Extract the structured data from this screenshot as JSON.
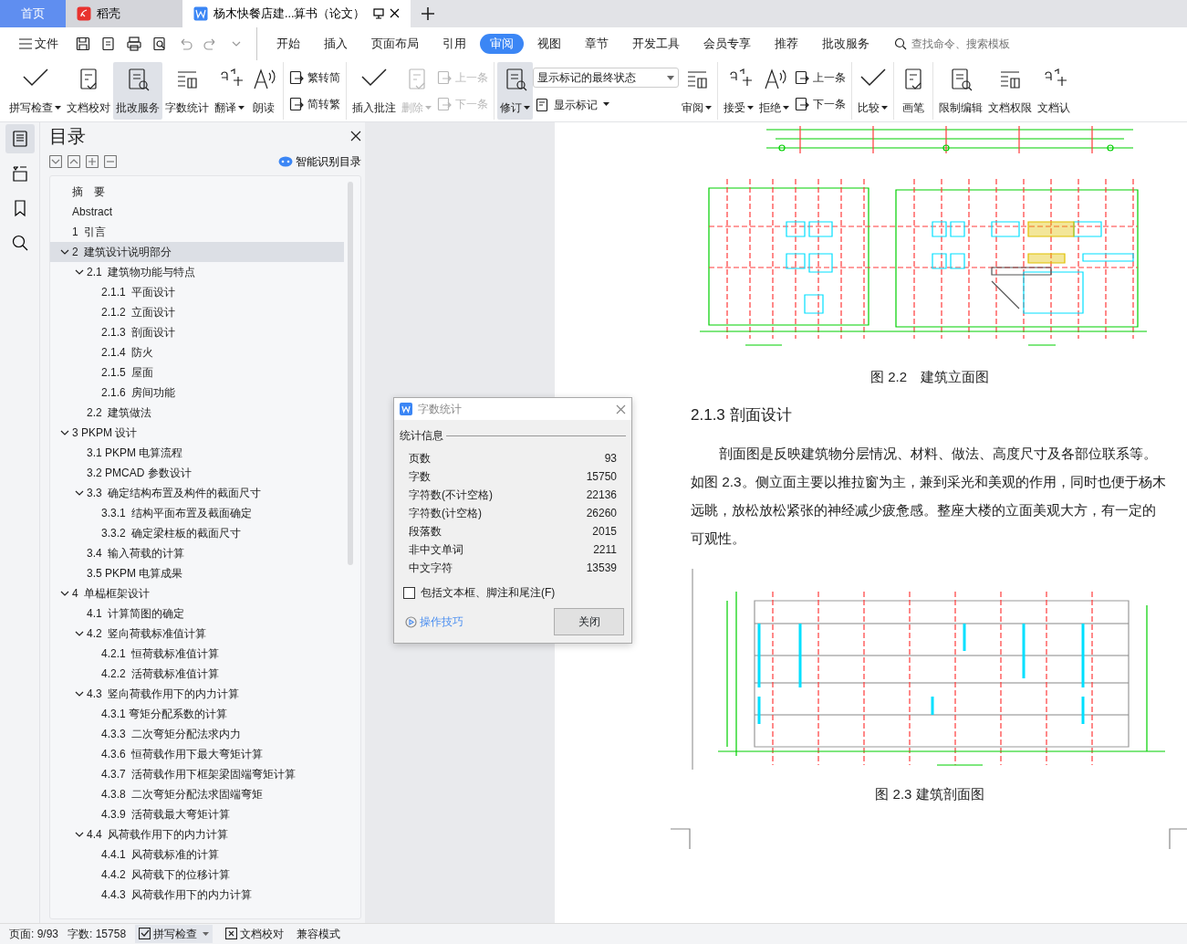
{
  "tabs": [
    {
      "kind": "home",
      "label": "首页",
      "selected": false
    },
    {
      "kind": "app",
      "label": "稻壳",
      "selected": false
    },
    {
      "kind": "doc",
      "label": "杨木快餐店建...算书（论文）",
      "selected": true
    }
  ],
  "menu": {
    "file": "文件",
    "tabs": [
      {
        "label": "开始",
        "selected": false
      },
      {
        "label": "插入",
        "selected": false
      },
      {
        "label": "页面布局",
        "selected": false
      },
      {
        "label": "引用",
        "selected": false
      },
      {
        "label": "审阅",
        "selected": true
      },
      {
        "label": "视图",
        "selected": false
      },
      {
        "label": "章节",
        "selected": false
      },
      {
        "label": "开发工具",
        "selected": false
      },
      {
        "label": "会员专享",
        "selected": false
      },
      {
        "label": "推荐",
        "selected": false
      },
      {
        "label": "批改服务",
        "selected": false
      }
    ],
    "search": {
      "placeholder": "查找命令、搜索模板"
    }
  },
  "ribbon": [
    {
      "items": [
        {
          "kind": "big",
          "label": "拼写检查",
          "menu": true,
          "disabled": false,
          "selected": false
        },
        {
          "kind": "big",
          "label": "文档校对",
          "menu": false,
          "disabled": false,
          "selected": false
        },
        {
          "kind": "big",
          "label": "批改服务",
          "menu": false,
          "disabled": false,
          "selected": true
        },
        {
          "kind": "big",
          "label": "字数统计",
          "menu": false,
          "disabled": false,
          "selected": false
        },
        {
          "kind": "big",
          "label": "翻译",
          "menu": true,
          "disabled": false,
          "selected": false
        },
        {
          "kind": "big",
          "label": "朗读",
          "menu": false,
          "disabled": false,
          "selected": false
        }
      ]
    },
    {
      "items": [
        {
          "kind": "stack",
          "entries": [
            {
              "label": "繁转简",
              "disabled": false
            },
            {
              "label": "简转繁",
              "disabled": false
            }
          ]
        }
      ]
    },
    {
      "items": [
        {
          "kind": "big",
          "label": "插入批注",
          "menu": false,
          "disabled": false,
          "selected": false
        },
        {
          "kind": "big",
          "label": "删除",
          "menu": true,
          "disabled": true,
          "selected": false
        },
        {
          "kind": "stack",
          "entries": [
            {
              "label": "上一条",
              "disabled": true
            },
            {
              "label": "下一条",
              "disabled": true
            }
          ]
        }
      ]
    },
    {
      "items": [
        {
          "kind": "big",
          "label": "修订",
          "menu": true,
          "disabled": false,
          "selected": true
        },
        {
          "kind": "select",
          "value": "显示标记的最终状态",
          "entry": {
            "label": "显示标记",
            "menu": true
          }
        },
        {
          "kind": "big",
          "label": "审阅",
          "menu": true,
          "disabled": false,
          "selected": false
        }
      ]
    },
    {
      "items": [
        {
          "kind": "big",
          "label": "接受",
          "menu": true,
          "disabled": false,
          "selected": false
        },
        {
          "kind": "big",
          "label": "拒绝",
          "menu": true,
          "disabled": false,
          "selected": false
        },
        {
          "kind": "stack",
          "entries": [
            {
              "label": "上一条",
              "disabled": false
            },
            {
              "label": "下一条",
              "disabled": false
            }
          ]
        }
      ]
    },
    {
      "items": [
        {
          "kind": "big",
          "label": "比较",
          "menu": true,
          "disabled": false,
          "selected": false
        }
      ]
    },
    {
      "items": [
        {
          "kind": "big",
          "label": "画笔",
          "menu": false,
          "disabled": false,
          "selected": false
        }
      ]
    },
    {
      "items": [
        {
          "kind": "big",
          "label": "限制编辑",
          "menu": false,
          "disabled": false,
          "selected": false
        },
        {
          "kind": "big",
          "label": "文档权限",
          "menu": false,
          "disabled": false,
          "selected": false
        },
        {
          "kind": "big",
          "label": "文档认",
          "menu": false,
          "disabled": false,
          "selected": false
        }
      ]
    }
  ],
  "rail": [
    {
      "selected": true
    },
    {
      "selected": false
    },
    {
      "selected": false
    },
    {
      "selected": false
    }
  ],
  "outline": {
    "title": "目录",
    "smart_button": "智能识别目录",
    "items": [
      {
        "label": "摘　要",
        "selected": false
      },
      {
        "label": "Abstract",
        "selected": false
      },
      {
        "label": "1  引言",
        "selected": false
      },
      {
        "label": "2  建筑设计说明部分",
        "selected": true,
        "expanded": true,
        "children": [
          {
            "label": "2.1  建筑物功能与特点",
            "selected": false,
            "expanded": true,
            "children": [
              {
                "label": "2.1.1  平面设计",
                "selected": false
              },
              {
                "label": "2.1.2  立面设计",
                "selected": false
              },
              {
                "label": "2.1.3  剖面设计",
                "selected": false
              },
              {
                "label": "2.1.4  防火",
                "selected": false
              },
              {
                "label": "2.1.5  屋面",
                "selected": false
              },
              {
                "label": "2.1.6  房间功能",
                "selected": false
              }
            ]
          },
          {
            "label": "2.2  建筑做法",
            "selected": false
          }
        ]
      },
      {
        "label": "3 PKPM 设计",
        "selected": false,
        "expanded": true,
        "children": [
          {
            "label": "3.1 PKPM 电算流程",
            "selected": false
          },
          {
            "label": "3.2 PMCAD 参数设计",
            "selected": false
          },
          {
            "label": "3.3  确定结构布置及构件的截面尺寸",
            "selected": false,
            "expanded": true,
            "children": [
              {
                "label": "3.3.1  结构平面布置及截面确定",
                "selected": false
              },
              {
                "label": "3.3.2  确定梁柱板的截面尺寸",
                "selected": false
              }
            ]
          },
          {
            "label": "3.4  输入荷载的计算",
            "selected": false
          },
          {
            "label": "3.5 PKPM 电算成果",
            "selected": false
          }
        ]
      },
      {
        "label": "4  单榀框架设计",
        "selected": false,
        "expanded": true,
        "children": [
          {
            "label": "4.1  计算简图的确定",
            "selected": false
          },
          {
            "label": "4.2  竖向荷载标准值计算",
            "selected": false,
            "expanded": true,
            "children": [
              {
                "label": "4.2.1  恒荷载标准值计算",
                "selected": false
              },
              {
                "label": "4.2.2  活荷载标准值计算",
                "selected": false
              }
            ]
          },
          {
            "label": "4.3  竖向荷载作用下的内力计算",
            "selected": false,
            "expanded": true,
            "children": [
              {
                "label": "4.3.1 弯矩分配系数的计算",
                "selected": false
              },
              {
                "label": "4.3.3  二次弯矩分配法求内力",
                "selected": false
              },
              {
                "label": "4.3.6  恒荷载作用下最大弯矩计算",
                "selected": false
              },
              {
                "label": "4.3.7  活荷载作用下框架梁固端弯矩计算",
                "selected": false
              },
              {
                "label": "4.3.8  二次弯矩分配法求固端弯矩",
                "selected": false
              },
              {
                "label": "4.3.9  活荷载最大弯矩计算",
                "selected": false
              }
            ]
          },
          {
            "label": "4.4  风荷载作用下的内力计算",
            "selected": false,
            "expanded": true,
            "children": [
              {
                "label": "4.4.1  风荷载标准的计算",
                "selected": false
              },
              {
                "label": "4.4.2  风荷载下的位移计算",
                "selected": false
              },
              {
                "label": "4.4.3  风荷载作用下的内力计算",
                "selected": false
              }
            ]
          }
        ]
      }
    ]
  },
  "document": {
    "blocks": [
      {
        "kind": "plan"
      },
      {
        "kind": "elevation"
      },
      {
        "kind": "caption",
        "text": "图 2.2　建筑立面图"
      },
      {
        "kind": "heading",
        "text": "2.1.3  剖面设计"
      },
      {
        "kind": "paragraph",
        "text": "剖面图是反映建筑物分层情况、材料、做法、高度尺寸及各部位联系等。如图 2.3。侧立面主要以推拉窗为主，兼到采光和美观的作用，同时也便于杨木远眺，放松放松紧张的神经减少疲惫感。整座大楼的立面美观大方，有一定的可观性。"
      },
      {
        "kind": "section"
      },
      {
        "kind": "caption",
        "text": "图 2.3 建筑剖面图"
      }
    ]
  },
  "dialog": {
    "title": "字数统计",
    "group": "统计信息",
    "rows": [
      {
        "label": "页数",
        "value": "93"
      },
      {
        "label": "字数",
        "value": "15750"
      },
      {
        "label": "字符数(不计空格)",
        "value": "22136"
      },
      {
        "label": "字符数(计空格)",
        "value": "26260"
      },
      {
        "label": "段落数",
        "value": "2015"
      },
      {
        "label": "非中文单词",
        "value": "2211"
      },
      {
        "label": "中文字符",
        "value": "13539"
      }
    ],
    "checkbox": {
      "label": "包括文本框、脚注和尾注(F)",
      "checked": false
    },
    "tips": "操作技巧",
    "close": "关闭"
  },
  "status_bar": {
    "page": "页面: 9/93",
    "words": "字数: 15758",
    "spell": "拼写检查",
    "proof": "文档校对",
    "mode": "兼容模式"
  }
}
